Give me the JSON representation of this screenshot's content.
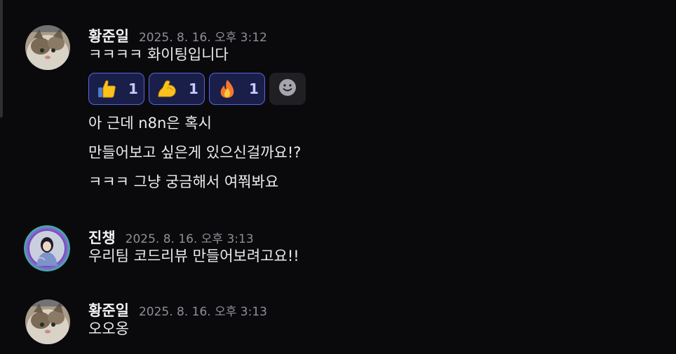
{
  "messages": [
    {
      "author": "황준일",
      "timestamp": "2025. 8. 16. 오후 3:12",
      "lines": [
        "ㅋㅋㅋㅋ 화이팅입니다"
      ],
      "reactions": [
        {
          "emoji": "thumbs-up",
          "count": "1"
        },
        {
          "emoji": "flexed-biceps",
          "count": "1"
        },
        {
          "emoji": "fire",
          "count": "1"
        }
      ],
      "followups": [
        "아 근데 n8n은 혹시",
        "만들어보고 싶은게 있으신걸까요!?",
        "ㅋㅋㅋ 그냥 궁금해서 여쭤봐요"
      ]
    },
    {
      "author": "진챙",
      "timestamp": "2025. 8. 16. 오후 3:13",
      "lines": [
        "우리팀 코드리뷰 만들어보려고요!!"
      ]
    },
    {
      "author": "황준일",
      "timestamp": "2025. 8. 16. 오후 3:13",
      "lines": [
        "오오옹"
      ]
    }
  ],
  "colors": {
    "background": "#0a0a0d",
    "reaction_border": "#5865d9",
    "reaction_bg": "#1a1f4a",
    "timestamp": "#8e8e96"
  },
  "icons": {
    "add_reaction": "smiley-add-icon"
  }
}
